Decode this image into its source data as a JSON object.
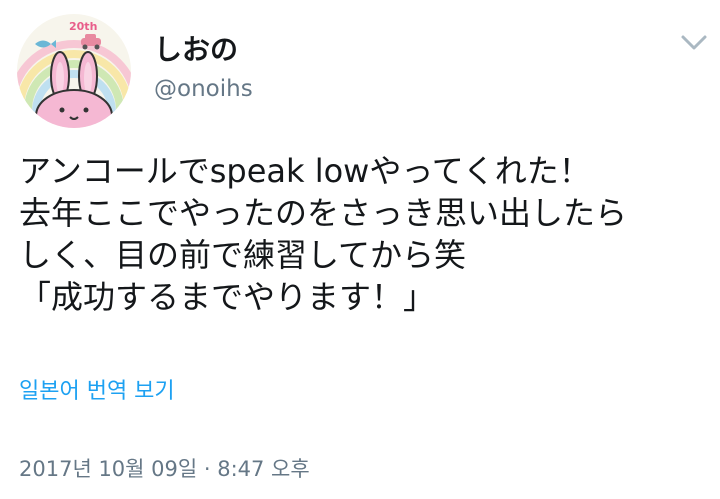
{
  "user": {
    "display_name": "しおの",
    "handle": "@onoihs",
    "avatar_badge": "20th"
  },
  "tweet": {
    "lines": [
      "アンコールでspeak lowやってくれた！",
      "去年ここでやったのをさっき思い出したら",
      "しく、目の前で練習してから笑",
      "「成功するまでやります！」"
    ],
    "translate_label": "일본어 번역 보기",
    "timestamp": "2017년 10월 09일 · 8:47 오후"
  },
  "colors": {
    "link": "#1da1f2",
    "secondary_text": "#657786",
    "primary_text": "#14171a"
  },
  "icons": {
    "menu": "chevron-down-icon"
  }
}
